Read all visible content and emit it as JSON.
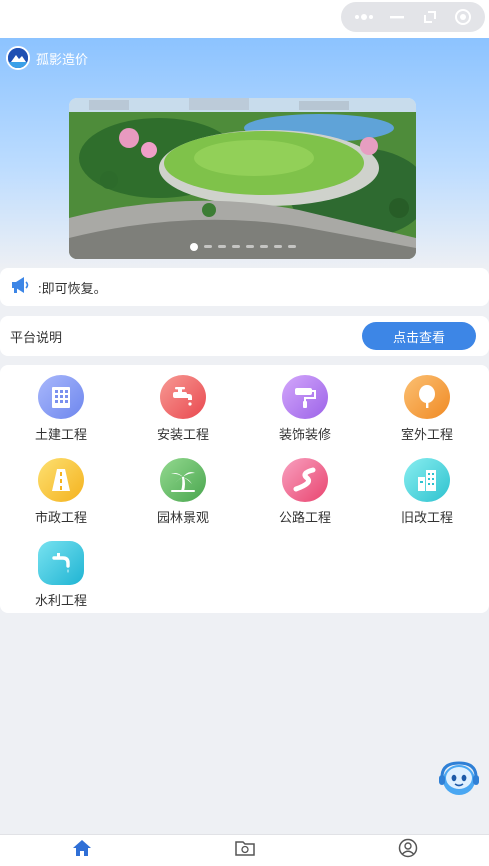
{
  "app": {
    "name": "孤影造价"
  },
  "notice": {
    "text": ":即可恢复。"
  },
  "platform": {
    "label": "平台说明",
    "button_label": "点击查看"
  },
  "banner": {
    "slide_count": 8,
    "active_index": 0
  },
  "categories": [
    {
      "label": "土建工程",
      "icon": "building-icon",
      "color": "#8fa6f5"
    },
    {
      "label": "安装工程",
      "icon": "faucet-icon",
      "color": "#f06a6a"
    },
    {
      "label": "装饰装修",
      "icon": "paint-roller-icon",
      "color": "#b985f0"
    },
    {
      "label": "室外工程",
      "icon": "tree-icon",
      "color": "#f5a542"
    },
    {
      "label": "市政工程",
      "icon": "road-icon",
      "color": "#f7c93e"
    },
    {
      "label": "园林景观",
      "icon": "palm-tree-icon",
      "color": "#6dc07a"
    },
    {
      "label": "公路工程",
      "icon": "highway-icon",
      "color": "#f06d9a"
    },
    {
      "label": "旧改工程",
      "icon": "old-building-icon",
      "color": "#56d2d9"
    },
    {
      "label": "水利工程",
      "icon": "water-tap-icon",
      "color": "#47c8e0"
    }
  ],
  "tabs": [
    {
      "name": "home",
      "icon": "home-icon",
      "active": true
    },
    {
      "name": "works",
      "icon": "folder-icon",
      "active": false
    },
    {
      "name": "profile",
      "icon": "user-icon",
      "active": false
    }
  ],
  "colors": {
    "accent": "#3d86e6",
    "tab_active": "#2f6fd6",
    "tab_inactive": "#555555"
  }
}
